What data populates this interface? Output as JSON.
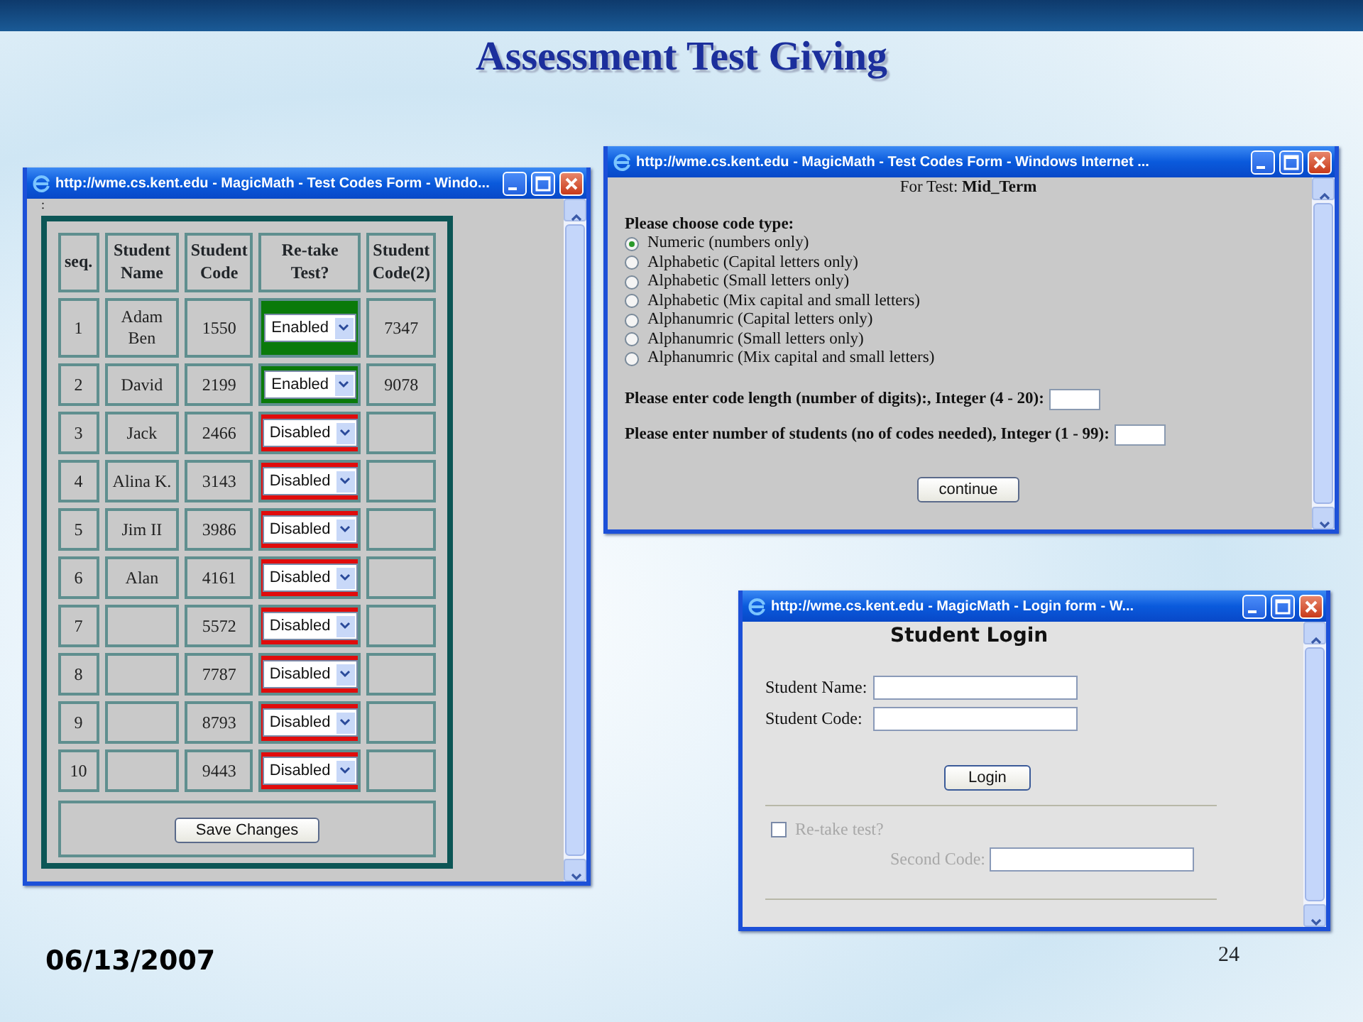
{
  "slide": {
    "title": "Assessment Test Giving",
    "date": "06/13/2007",
    "page_number": "24"
  },
  "windows": [
    {
      "kind": "codes_table",
      "title": "http://wme.cs.kent.edu - MagicMath - Test Codes Form - Windo...",
      "note": ":",
      "columns": [
        "seq.",
        "Student Name",
        "Student Code",
        "Re-take Test?",
        "Student Code(2)"
      ],
      "rows": [
        {
          "seq": "1",
          "name": "Adam Ben",
          "code": "1550",
          "retake": "Enabled",
          "enabled": true,
          "code2": "7347"
        },
        {
          "seq": "2",
          "name": "David",
          "code": "2199",
          "retake": "Enabled",
          "enabled": true,
          "code2": "9078"
        },
        {
          "seq": "3",
          "name": "Jack",
          "code": "2466",
          "retake": "Disabled",
          "enabled": false,
          "code2": ""
        },
        {
          "seq": "4",
          "name": "Alina K.",
          "code": "3143",
          "retake": "Disabled",
          "enabled": false,
          "code2": ""
        },
        {
          "seq": "5",
          "name": "Jim II",
          "code": "3986",
          "retake": "Disabled",
          "enabled": false,
          "code2": ""
        },
        {
          "seq": "6",
          "name": "Alan",
          "code": "4161",
          "retake": "Disabled",
          "enabled": false,
          "code2": ""
        },
        {
          "seq": "7",
          "name": "",
          "code": "5572",
          "retake": "Disabled",
          "enabled": false,
          "code2": ""
        },
        {
          "seq": "8",
          "name": "",
          "code": "7787",
          "retake": "Disabled",
          "enabled": false,
          "code2": ""
        },
        {
          "seq": "9",
          "name": "",
          "code": "8793",
          "retake": "Disabled",
          "enabled": false,
          "code2": ""
        },
        {
          "seq": "10",
          "name": "",
          "code": "9443",
          "retake": "Disabled",
          "enabled": false,
          "code2": ""
        }
      ],
      "button": "Save Changes"
    },
    {
      "kind": "code_type",
      "title": "http://wme.cs.kent.edu - MagicMath - Test Codes Form - Windows Internet ...",
      "test_line": "For Test: **Mid_Term**",
      "prompt": "Please choose code type:",
      "options": [
        {
          "label": "Numeric (numbers only)",
          "selected": true
        },
        {
          "label": "Alphabetic (Capital letters only)",
          "selected": false
        },
        {
          "label": "Alphabetic (Small letters only)",
          "selected": false
        },
        {
          "label": "Alphabetic (Mix capital and small letters)",
          "selected": false
        },
        {
          "label": "Alphanumric (Capital letters only)",
          "selected": false
        },
        {
          "label": "Alphanumric (Small letters only)",
          "selected": false
        },
        {
          "label": "Alphanumric (Mix capital and small letters)",
          "selected": false
        }
      ],
      "fields": [
        {
          "label": "Please enter code length (number of digits):, Integer (4 - 20):"
        },
        {
          "label": "Please enter number of students (no of codes needed), Integer (1 - 99):"
        }
      ],
      "button": "continue"
    },
    {
      "kind": "login",
      "title": "http://wme.cs.kent.edu - MagicMath - Login form - W...",
      "heading": "Student Login",
      "fields": [
        {
          "label": "Student Name:"
        },
        {
          "label": "Student Code:"
        }
      ],
      "button": "Login",
      "retake": {
        "label": "Re-take test?",
        "checked": false,
        "disabled": true
      },
      "second_code": {
        "label": "Second Code:",
        "disabled": true
      }
    }
  ]
}
